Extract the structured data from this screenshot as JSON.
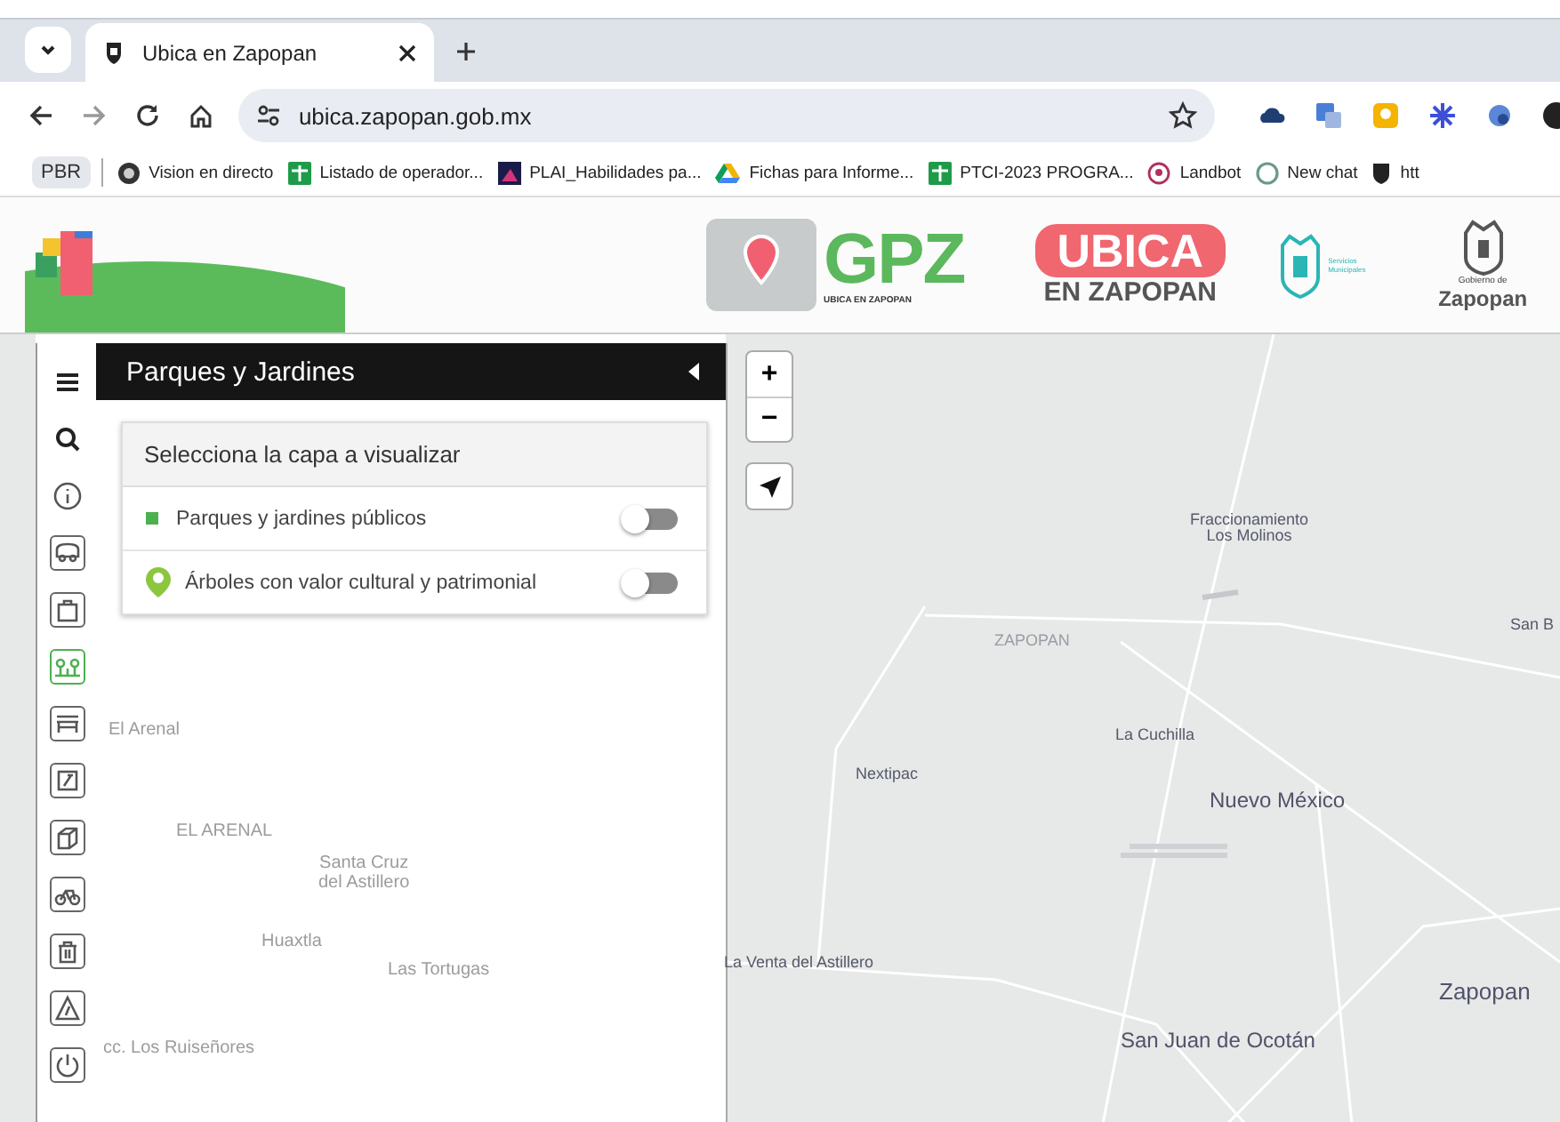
{
  "browser": {
    "tab_title": "Ubica en Zapopan",
    "url": "ubica.zapopan.gob.mx",
    "bookmarks": [
      {
        "label": "PBR",
        "kind": "chip"
      },
      {
        "label": "Vision en directo",
        "kind": "camera"
      },
      {
        "label": "Listado de operador...",
        "kind": "sheet"
      },
      {
        "label": "PLAI_Habilidades pa...",
        "kind": "plai"
      },
      {
        "label": "Fichas para Informe...",
        "kind": "drive"
      },
      {
        "label": "PTCI-2023 PROGRA...",
        "kind": "sheet"
      },
      {
        "label": "Landbot",
        "kind": "pin"
      },
      {
        "label": "New chat",
        "kind": "chat"
      },
      {
        "label": "htt",
        "kind": "shield"
      }
    ]
  },
  "header": {
    "gpz": "GPZ",
    "gpz_caption": "UBICA EN ZAPOPAN",
    "ubica": "UBICA",
    "ubica_sub": "EN ZAPOPAN",
    "services": "Servicios Municipales",
    "gov_small": "Gobierno de",
    "gov": "Zapopan"
  },
  "tools": [
    {
      "kind": "menu",
      "selected": false
    },
    {
      "kind": "search",
      "selected": false
    },
    {
      "kind": "info",
      "selected": false
    },
    {
      "kind": "bus",
      "selected": false
    },
    {
      "kind": "bag",
      "selected": false
    },
    {
      "kind": "park",
      "selected": true
    },
    {
      "kind": "bench",
      "selected": false
    },
    {
      "kind": "sport",
      "selected": false
    },
    {
      "kind": "cube",
      "selected": false
    },
    {
      "kind": "bike",
      "selected": false
    },
    {
      "kind": "trash",
      "selected": false
    },
    {
      "kind": "road",
      "selected": false
    },
    {
      "kind": "power",
      "selected": false
    }
  ],
  "panel": {
    "title": "Parques y Jardines",
    "card_title": "Selecciona la capa a visualizar",
    "layers": [
      {
        "label": "Parques y jardines públicos",
        "kind": "square",
        "on": false
      },
      {
        "label": "Árboles con valor cultural y patrimonial",
        "kind": "pin",
        "on": false
      }
    ]
  },
  "map": {
    "zoom_in": "+",
    "zoom_out": "−",
    "labels": [
      {
        "text": "Fraccionamiento\nLos Molinos",
        "kind": "small"
      },
      {
        "text": "ZAPOPAN",
        "kind": "area"
      },
      {
        "text": "San B",
        "kind": "small"
      },
      {
        "text": "La Cuchilla",
        "kind": "small"
      },
      {
        "text": "Nextipac",
        "kind": "small"
      },
      {
        "text": "Nuevo México",
        "kind": "town"
      },
      {
        "text": "La Venta del Astillero",
        "kind": "small"
      },
      {
        "text": "Zapopan",
        "kind": "city"
      },
      {
        "text": "San Juan de Ocotán",
        "kind": "town"
      },
      {
        "text": "El Arenal",
        "kind": "faded"
      },
      {
        "text": "EL ARENAL",
        "kind": "faded"
      },
      {
        "text": "Santa Cruz\ndel Astillero",
        "kind": "faded"
      },
      {
        "text": "Huaxtla",
        "kind": "faded"
      },
      {
        "text": "Las Tortugas",
        "kind": "faded"
      },
      {
        "text": "cc. Los Ruiseñores",
        "kind": "faded"
      }
    ]
  }
}
